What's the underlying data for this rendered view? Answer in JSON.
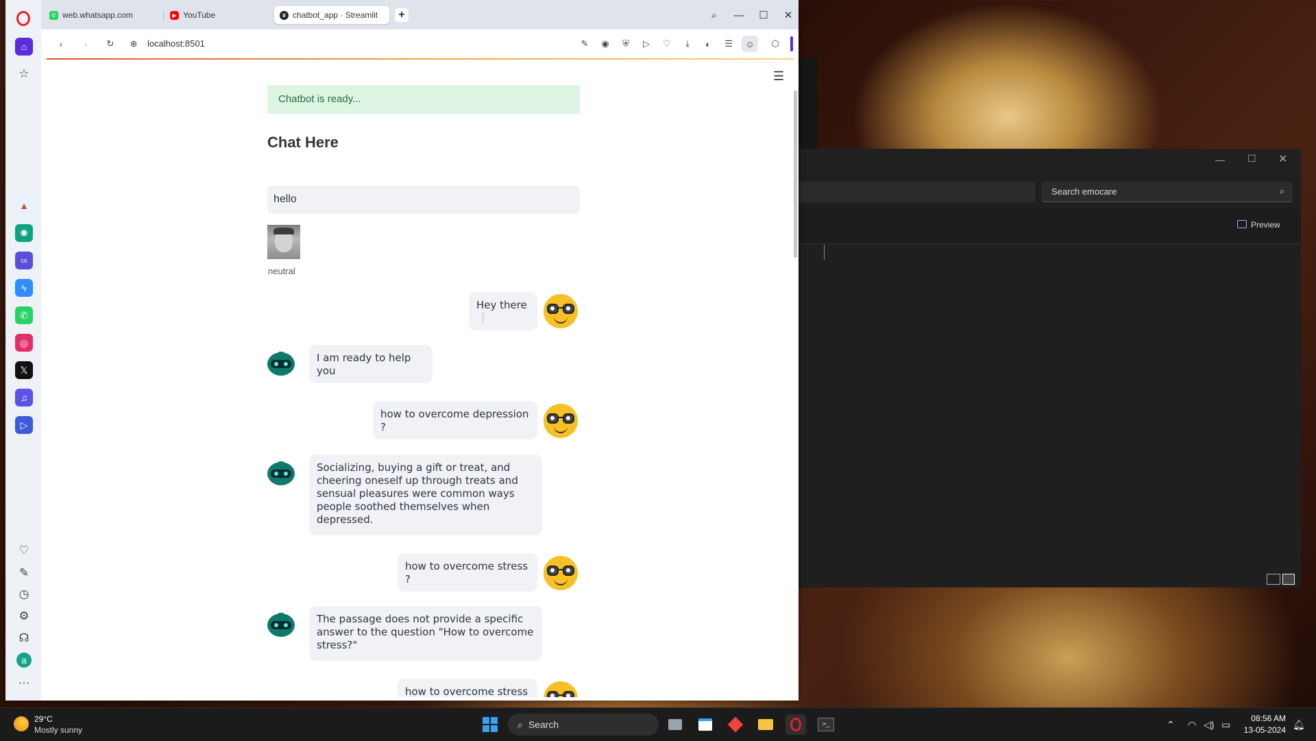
{
  "browser": {
    "tabs": [
      {
        "label": "web.whatsapp.com",
        "favicon": "whatsapp-icon"
      },
      {
        "label": "YouTube",
        "favicon": "youtube-icon"
      },
      {
        "label": "chatbot_app · Streamlit",
        "favicon": "streamlit-icon"
      }
    ],
    "new_tab": "+",
    "address": "localhost:8501",
    "accent": "#5b2bde"
  },
  "sidebar": {
    "apps": [
      "aria-icon",
      "chatgpt-icon",
      "chatsonic-icon",
      "messenger-icon",
      "whatsapp-icon",
      "instagram-icon",
      "x-icon",
      "music-icon",
      "player-icon"
    ],
    "bottom": [
      "heart-icon",
      "pinboard-icon",
      "history-icon",
      "settings-icon",
      "tips-icon",
      "account-icon",
      "more-icon"
    ]
  },
  "app": {
    "status": "Chatbot is ready...",
    "heading": "Chat Here",
    "input_value": "hello",
    "emotion_label": "neutral",
    "messages": [
      {
        "role": "user",
        "text": "Hey there ❕"
      },
      {
        "role": "bot",
        "text": "I am ready to help you"
      },
      {
        "role": "user",
        "text": "how to overcome depression ?"
      },
      {
        "role": "bot",
        "text": "Socializing, buying a gift or treat, and cheering oneself up through treats and sensual pleasures were common ways people soothed themselves when depressed."
      },
      {
        "role": "user",
        "text": "how to overcome stress ?"
      },
      {
        "role": "bot",
        "text": "The passage does not provide a specific answer to the question \"How to overcome stress?\""
      },
      {
        "role": "user",
        "text": "how to overcome stress ?"
      }
    ]
  },
  "explorer": {
    "search_placeholder": "Search emocare",
    "preview_label": "Preview"
  },
  "taskbar": {
    "weather_temp": "29°C",
    "weather_desc": "Mostly sunny",
    "search_label": "Search",
    "time": "08:56 AM",
    "date": "13-05-2024"
  }
}
